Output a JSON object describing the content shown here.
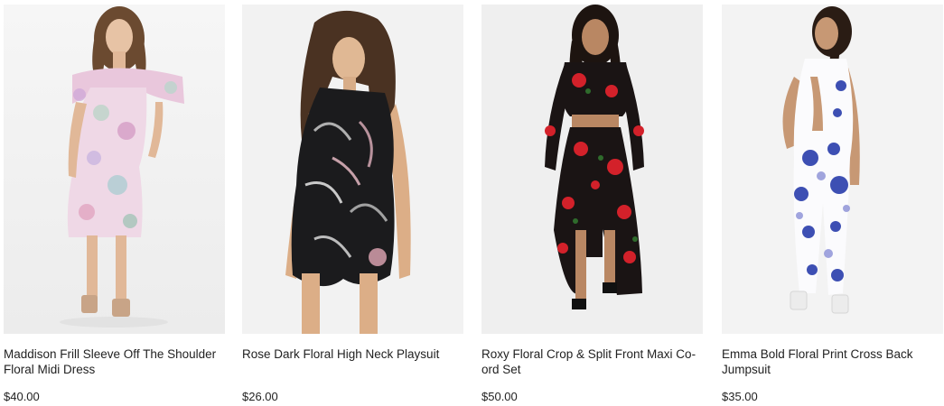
{
  "products": [
    {
      "name": "Maddison Frill Sleeve Off The Shoulder Floral Midi Dress",
      "price": "$40.00"
    },
    {
      "name": "Rose Dark Floral High Neck Playsuit",
      "price": "$26.00"
    },
    {
      "name": "Roxy Floral Crop & Split Front Maxi Co-ord Set",
      "price": "$50.00"
    },
    {
      "name": "Emma Bold Floral Print Cross Back Jumpsuit",
      "price": "$35.00"
    }
  ],
  "colors": {
    "text": "#222222",
    "background": "#ffffff",
    "photo_background": "#f1f1f1"
  }
}
